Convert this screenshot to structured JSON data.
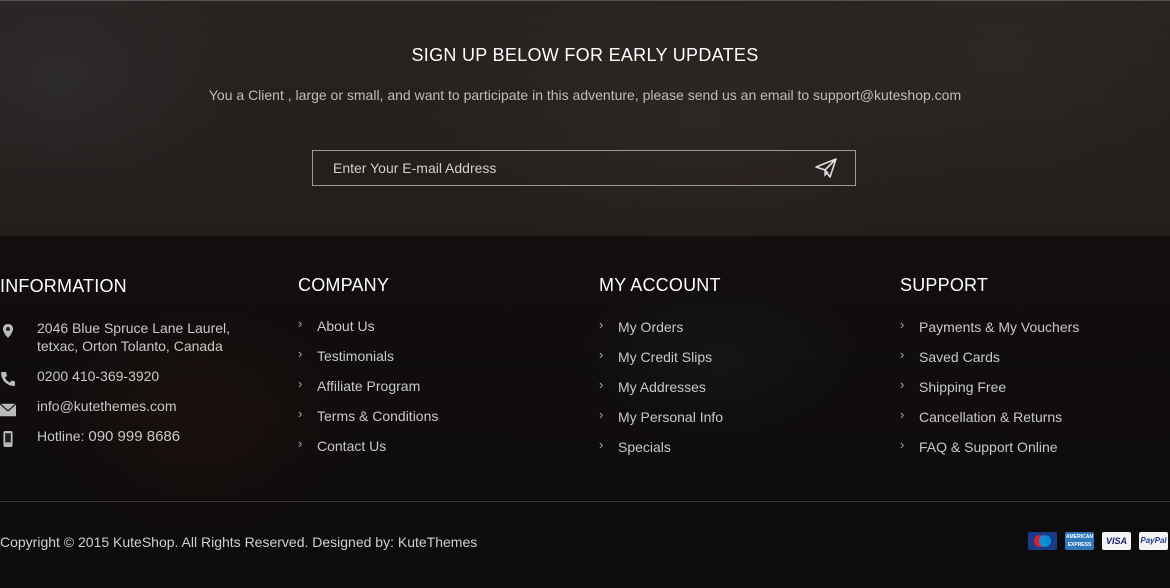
{
  "signup": {
    "title": "SIGN UP BELOW FOR EARLY UPDATES",
    "text": "You a Client , large or small, and want to participate in this adventure, please send us an email to support@kuteshop.com",
    "placeholder": "Enter Your E-mail Address",
    "send_icon": "paper-plane-icon"
  },
  "information": {
    "title": "INFORMATION",
    "address_line1": "2046 Blue Spruce Lane Laurel,",
    "address_line2": "tetxac, Orton Tolanto, Canada",
    "phone": "0200 410-369-3920",
    "email": "info@kutethemes.com",
    "hotline_label": "Hotline:",
    "hotline_number": "090 999 8686",
    "icons": [
      "map-pin-icon",
      "phone-icon",
      "envelope-icon",
      "mobile-icon"
    ]
  },
  "company": {
    "title": "COMPANY",
    "links": [
      "About Us",
      "Testimonials",
      "Affiliate Program",
      "Terms & Conditions",
      "Contact Us"
    ]
  },
  "account": {
    "title": "MY ACCOUNT",
    "links": [
      "My Orders",
      "My Credit Slips",
      "My Addresses",
      "My Personal Info",
      "Specials"
    ]
  },
  "support": {
    "title": "SUPPORT",
    "links": [
      "Payments & My Vouchers",
      "Saved Cards",
      "Shipping Free",
      "Cancellation & Returns",
      "FAQ & Support Online"
    ]
  },
  "footer": {
    "copyright": "Copyright © 2015 KuteShop. All Rights Reserved. Designed by: KuteThemes",
    "payments": [
      {
        "icon": "maestro-card-icon",
        "label": "Maestro",
        "bg": "#1a3a8a",
        "fg": "#ffffff"
      },
      {
        "icon": "amex-card-icon",
        "label": "AMERICAN EXPRESS",
        "bg": "#2e77bc",
        "fg": "#ffffff"
      },
      {
        "icon": "visa-card-icon",
        "label": "VISA",
        "bg": "#f4f4f4",
        "fg": "#1a1f71"
      },
      {
        "icon": "paypal-card-icon",
        "label": "PayPal",
        "bg": "#f4f4f4",
        "fg": "#1e3d8f"
      }
    ]
  }
}
